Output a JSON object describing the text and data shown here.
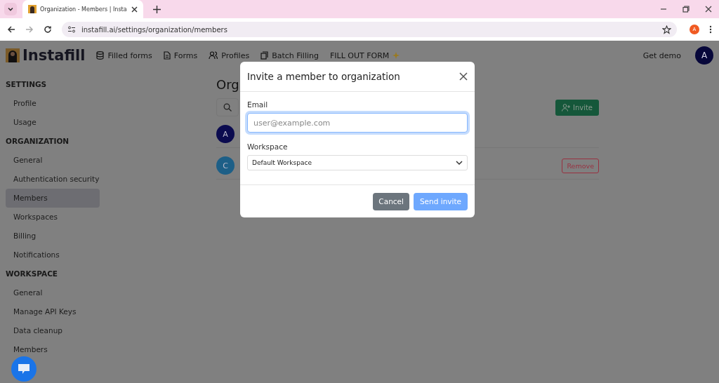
{
  "browser": {
    "tab_title": "Organization - Members | Insta",
    "url": "instafill.ai/settings/organization/members",
    "profile": "A"
  },
  "navbar": {
    "brand": "Instafill",
    "items": [
      {
        "label": "Filled forms",
        "kind": "database"
      },
      {
        "label": "Forms",
        "kind": "document"
      },
      {
        "label": "Profiles",
        "kind": "people"
      },
      {
        "label": "Batch Filling",
        "kind": "copy"
      },
      {
        "label": "FILL OUT FORM",
        "kind": "sparkle"
      }
    ],
    "get_demo": "Get demo",
    "user": "A"
  },
  "sidebar": {
    "sections": [
      {
        "title": "SETTINGS",
        "items": [
          {
            "label": "Profile",
            "selected": false
          },
          {
            "label": "Usage",
            "selected": false
          }
        ]
      },
      {
        "title": "ORGANIZATION",
        "items": [
          {
            "label": "General",
            "selected": false
          },
          {
            "label": "Authentication security",
            "selected": false
          },
          {
            "label": "Members",
            "selected": true
          },
          {
            "label": "Workspaces",
            "selected": false
          },
          {
            "label": "Billing",
            "selected": false
          },
          {
            "label": "Notifications",
            "selected": false
          }
        ]
      },
      {
        "title": "WORKSPACE",
        "items": [
          {
            "label": "General",
            "selected": false
          },
          {
            "label": "Manage API Keys",
            "selected": false
          },
          {
            "label": "Data cleanup",
            "selected": false
          },
          {
            "label": "Members",
            "selected": false
          }
        ]
      }
    ]
  },
  "page": {
    "title": "Org",
    "invite_button": "Invite",
    "members": [
      {
        "initial": "A",
        "color": "#0b0b4f"
      },
      {
        "initial": "C",
        "color": "#1d5f87",
        "action": "Remove"
      }
    ]
  },
  "modal": {
    "title": "Invite a member to organization",
    "email_label": "Email",
    "email_placeholder": "user@example.com",
    "workspace_label": "Workspace",
    "workspace_value": "Default Workspace",
    "cancel": "Cancel",
    "send": "Send invite"
  }
}
